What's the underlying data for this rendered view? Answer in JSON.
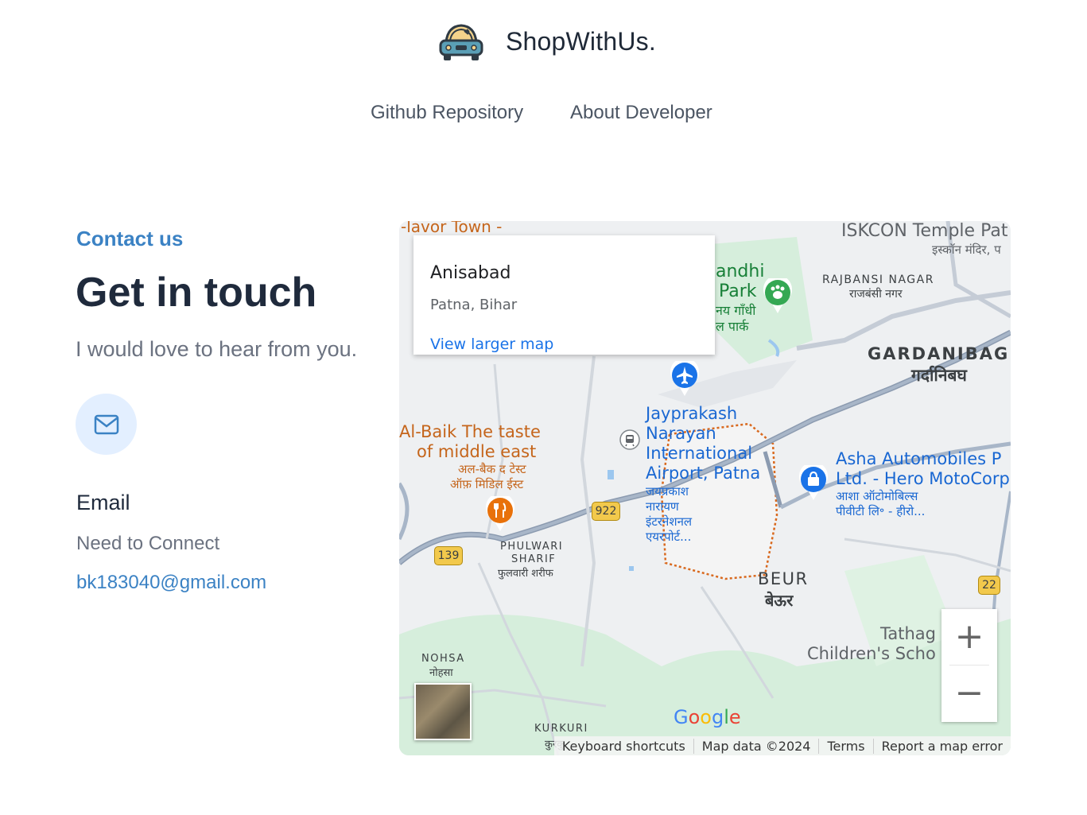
{
  "header": {
    "brand": "ShopWithUs.",
    "nav": {
      "github": "Github Repository",
      "about": "About Developer"
    }
  },
  "contact": {
    "eyebrow": "Contact us",
    "headline": "Get in touch",
    "subline": "I would love to hear from you.",
    "email_title": "Email",
    "email_note": "Need to Connect",
    "email_address": "bk183040@gmail.com"
  },
  "map": {
    "info": {
      "title": "Anisabad",
      "subtitle": "Patna, Bihar",
      "link": "View larger map"
    },
    "labels": {
      "flavor": "-lavor Town -",
      "iskcon": "ISKCON Temple Pat",
      "iskcon_hi": "इस्कॉन मंदिर, प",
      "gandhi": "andhi",
      "park": "Park",
      "gandhi_hi": "नय गाँधी",
      "park_hi": "ल पार्क",
      "rajbansi": "RAJBANSI NAGAR",
      "rajbansi_hi": "राजबंसी नगर",
      "gardanibag": "GARDANIBAG",
      "gardanibag_hi": "गर्दानिबघ",
      "airport_1": "Jayprakash",
      "airport_2": "Narayan",
      "airport_3": "International",
      "airport_4": "Airport, Patna",
      "airport_hi_1": "जयप्रकाश",
      "airport_hi_2": "नारायण",
      "airport_hi_3": "इंटरनेशनल",
      "airport_hi_4": "एयरपोर्ट...",
      "albaik_1": "Al-Baik The taste",
      "albaik_2": "of middle east",
      "albaik_hi_1": "अल-बैक द टेस्ट",
      "albaik_hi_2": "ऑफ़ मिडिल ईस्ट",
      "asha_1": "Asha Automobiles P",
      "asha_2": "Ltd. - Hero MotoCorp",
      "asha_hi_1": "आशा ऑटोमोबिल्स",
      "asha_hi_2": "पीवीटी लि॰ - हीरो...",
      "phulwari_1": "PHULWARI",
      "phulwari_2": "SHARIF",
      "phulwari_hi": "फुलवारी शरीफ",
      "beur": "BEUR",
      "beur_hi": "बेऊर",
      "tathag": "Tathag",
      "childrens": "Children's Scho",
      "nohsa": "NOHSA",
      "nohsa_hi": "नोहसा",
      "kurkuri": "KURKURI",
      "kurkuri_hi": "कुरकु",
      "shield_922": "922",
      "shield_139": "139",
      "shield_22": "22"
    },
    "zoom_in": "+",
    "zoom_out": "−",
    "google": "Google",
    "attribution": {
      "shortcuts": "Keyboard shortcuts",
      "data": "Map data ©2024",
      "terms": "Terms",
      "report": "Report a map error"
    }
  },
  "colors": {
    "accent": "#3b82c4",
    "headline": "#1f2a3c",
    "muted": "#6b7280",
    "badge_bg": "#e3efff",
    "map_label_orange": "#c5651b",
    "map_label_blue": "#1a73e8"
  },
  "icons": {
    "logo": "car-icon",
    "mail": "envelope-icon",
    "airport": "airplane-icon",
    "park": "paw-icon",
    "restaurant": "fork-knife-icon",
    "shop": "shopping-bag-icon",
    "transit": "train-icon"
  }
}
